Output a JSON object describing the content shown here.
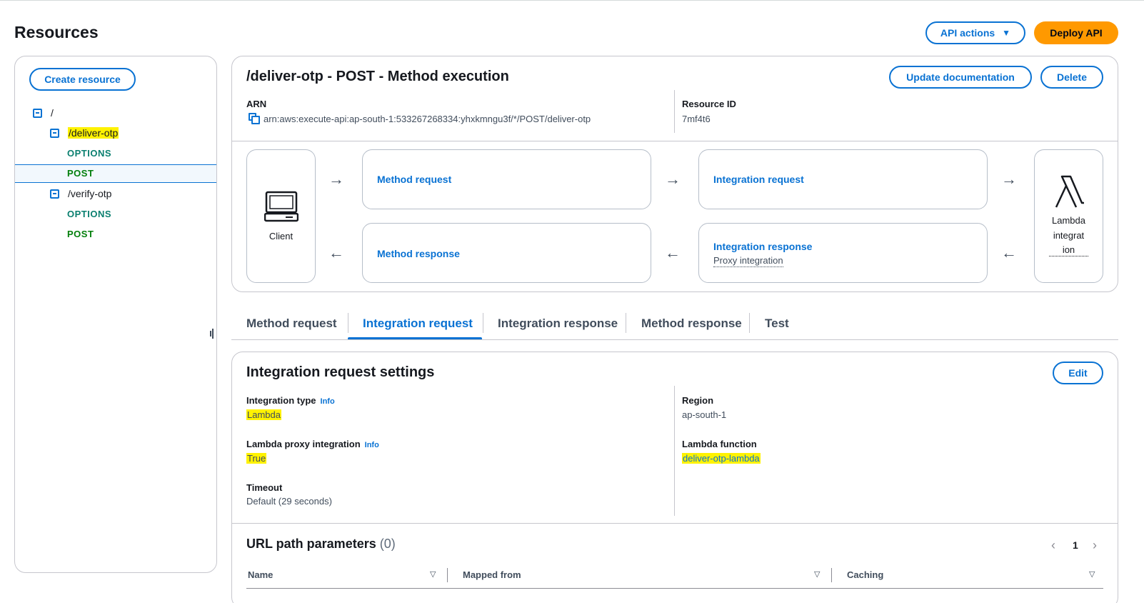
{
  "header": {
    "title": "Resources",
    "api_actions_label": "API actions",
    "deploy_label": "Deploy API"
  },
  "sidebar": {
    "create_resource_label": "Create resource",
    "root_label": "/",
    "items": [
      {
        "path": "/deliver-otp",
        "methods": [
          "OPTIONS",
          "POST"
        ]
      },
      {
        "path": "/verify-otp",
        "methods": [
          "OPTIONS",
          "POST"
        ]
      }
    ],
    "selected": "POST"
  },
  "method_execution": {
    "title": "/deliver-otp - POST - Method execution",
    "update_doc_label": "Update documentation",
    "delete_label": "Delete",
    "arn_label": "ARN",
    "arn_value": "arn:aws:execute-api:ap-south-1:533267268334:yhxkmngu3f/*/POST/deliver-otp",
    "resource_id_label": "Resource ID",
    "resource_id_value": "7mf4t6",
    "flow": {
      "client_label": "Client",
      "method_request": "Method request",
      "integration_request": "Integration request",
      "method_response": "Method response",
      "integration_response": "Integration response",
      "integration_response_sub": "Proxy integration",
      "lambda_label_1": "Lambda",
      "lambda_label_2": "integrat",
      "lambda_label_3": "ion"
    }
  },
  "tabs": [
    {
      "label": "Method request"
    },
    {
      "label": "Integration request"
    },
    {
      "label": "Integration response"
    },
    {
      "label": "Method response"
    },
    {
      "label": "Test"
    }
  ],
  "active_tab": "Integration request",
  "integration_settings": {
    "title": "Integration request settings",
    "edit_label": "Edit",
    "info_label": "Info",
    "integration_type_label": "Integration type",
    "integration_type_value": "Lambda",
    "proxy_label": "Lambda proxy integration",
    "proxy_value": "True",
    "timeout_label": "Timeout",
    "timeout_value": "Default (29 seconds)",
    "region_label": "Region",
    "region_value": "ap-south-1",
    "lambda_function_label": "Lambda function",
    "lambda_function_value": "deliver-otp-lambda"
  },
  "url_params": {
    "title": "URL path parameters",
    "count": "(0)",
    "page": "1",
    "columns": [
      "Name",
      "Mapped from",
      "Caching"
    ]
  },
  "colors": {
    "accent": "#0972d3",
    "primary_button": "#ff9900",
    "highlight": "#fff200",
    "method_green": "#037f0c"
  }
}
